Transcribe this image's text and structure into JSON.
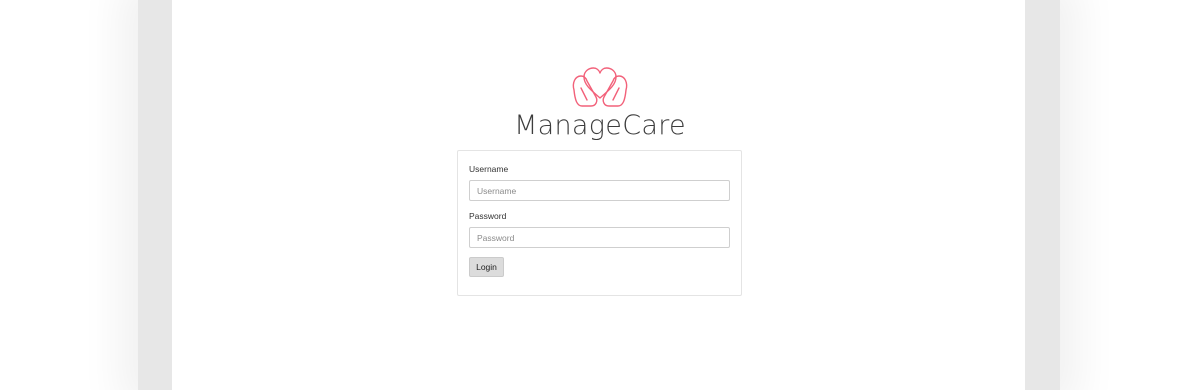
{
  "brand": {
    "name": "ManageCare",
    "logo_icon": "heart-hands-icon",
    "accent_color": "#f2617a"
  },
  "login_form": {
    "username": {
      "label": "Username",
      "placeholder": "Username",
      "value": ""
    },
    "password": {
      "label": "Password",
      "placeholder": "Password",
      "value": ""
    },
    "submit_label": "Login"
  }
}
